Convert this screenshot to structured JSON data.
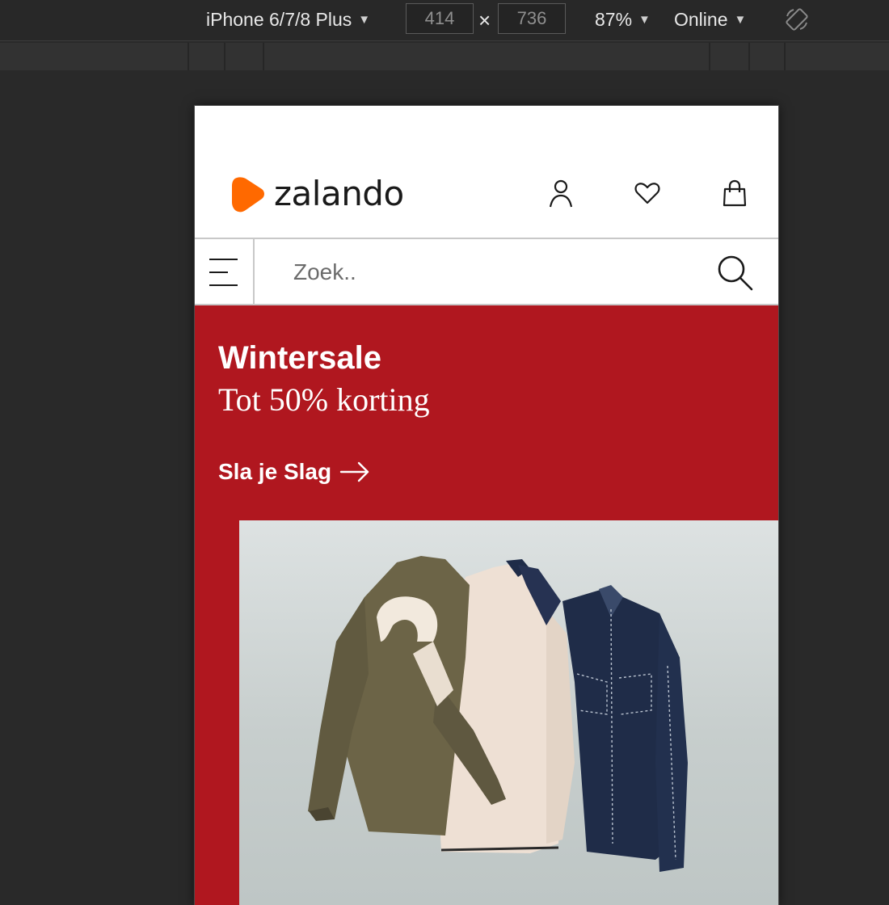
{
  "devtools": {
    "device": "iPhone 6/7/8 Plus",
    "width": "414",
    "times": "×",
    "height": "736",
    "zoom": "87%",
    "network": "Online"
  },
  "header": {
    "logo_text": "zalando",
    "brand_color": "#ff6900"
  },
  "search": {
    "placeholder": "Zoek.."
  },
  "promo": {
    "title": "Wintersale",
    "subtitle": "Tot 50% korting",
    "cta": "Sla je Slag",
    "background": "#b0171f"
  },
  "icons": {
    "account": "user-icon",
    "wishlist": "heart-icon",
    "cart": "bag-icon",
    "menu": "hamburger-icon",
    "search": "search-icon",
    "cta": "arrow-right-icon",
    "rotate": "rotate-icon"
  }
}
